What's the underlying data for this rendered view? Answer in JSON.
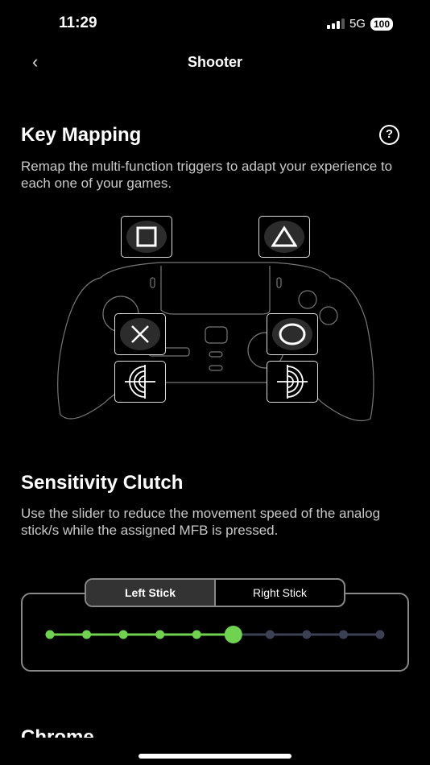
{
  "status_bar": {
    "time": "11:29",
    "network": "5G",
    "battery": "100"
  },
  "nav": {
    "title": "Shooter",
    "back_icon": "chevron-left-icon"
  },
  "key_mapping": {
    "title": "Key Mapping",
    "description": "Remap the multi-function triggers to adapt your experience to each one of your games.",
    "help_icon": "question-circle-icon",
    "buttons": [
      "square",
      "triangle",
      "cross",
      "circle",
      "left-stick-target",
      "right-stick-target"
    ]
  },
  "sensitivity": {
    "title": "Sensitivity Clutch",
    "description": "Use the slider to reduce the movement speed of the analog stick/s while the assigned MFB is pressed.",
    "tabs": [
      {
        "label": "Left Stick",
        "selected": true
      },
      {
        "label": "Right Stick",
        "selected": false
      }
    ],
    "slider": {
      "steps": 10,
      "value": 6
    },
    "active_color": "#6fd34f",
    "inactive_color": "#3b4153"
  },
  "next_section": {
    "title": "Chrome"
  }
}
